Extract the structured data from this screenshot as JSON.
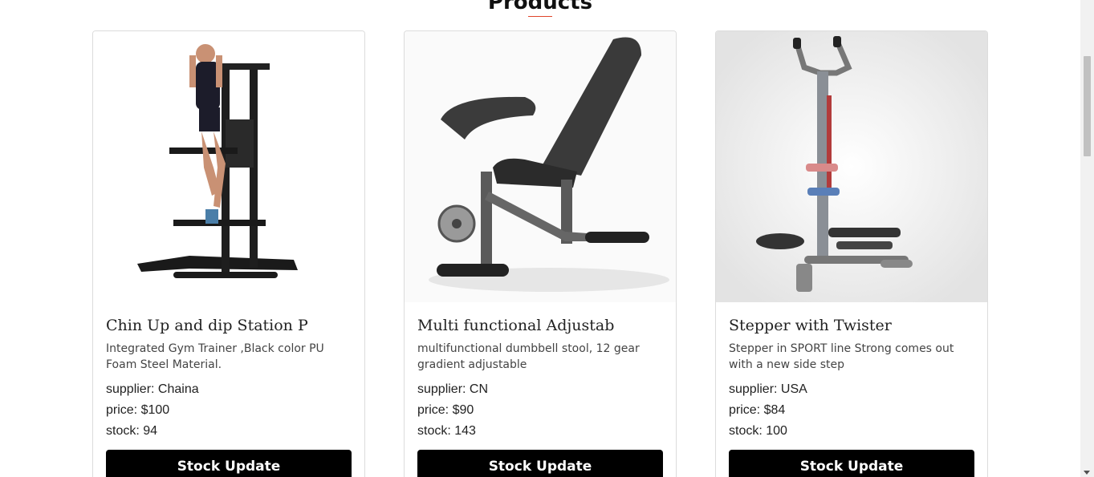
{
  "section": {
    "title": "Products"
  },
  "products": [
    {
      "name": "Chin Up and dip Station P",
      "description": "Integrated Gym Trainer ,Black color PU Foam Steel Material.",
      "supplier": "supplier: Chaina",
      "price": "price: $100",
      "stock": "stock: 94",
      "button_label": "Stock Update",
      "image_icon": "pull-up-station-image"
    },
    {
      "name": "Multi functional Adjustab",
      "description": "multifunctional dumbbell stool, 12 gear gradient adjustable",
      "supplier": "supplier: CN",
      "price": "price: $90",
      "stock": "stock: 143",
      "button_label": "Stock Update",
      "image_icon": "adjustable-bench-image"
    },
    {
      "name": "Stepper with Twister",
      "description": "Stepper in SPORT line Strong comes out with a new side step",
      "supplier": "supplier: USA",
      "price": "price: $84",
      "stock": "stock: 100",
      "button_label": "Stock Update",
      "image_icon": "stepper-image"
    }
  ],
  "colors": {
    "accent": "#e0452b",
    "button": "#000000",
    "border": "#dcdcdc"
  }
}
